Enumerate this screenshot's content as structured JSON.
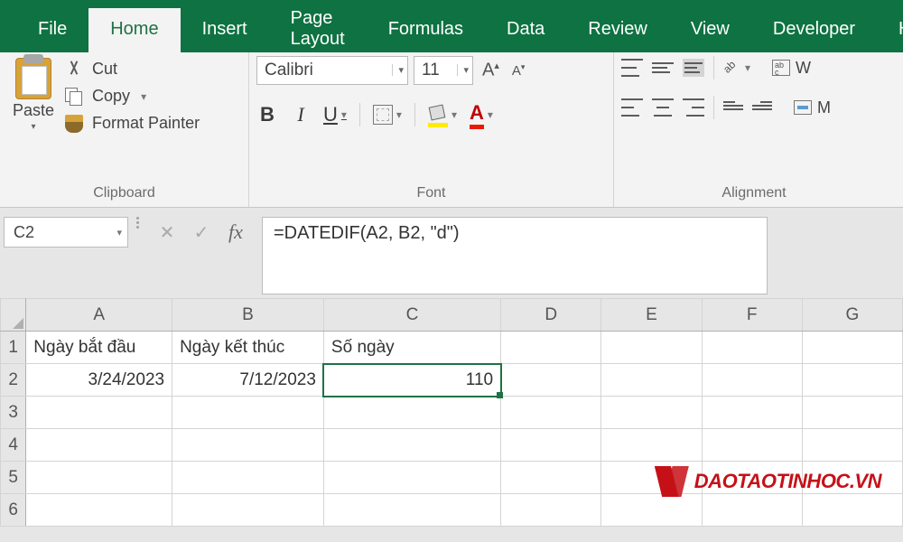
{
  "tabs": {
    "file": "File",
    "home": "Home",
    "insert": "Insert",
    "pageLayout": "Page Layout",
    "formulas": "Formulas",
    "data": "Data",
    "review": "Review",
    "view": "View",
    "developer": "Developer",
    "help": "H"
  },
  "clipboard": {
    "paste": "Paste",
    "cut": "Cut",
    "copy": "Copy",
    "formatPainter": "Format Painter",
    "label": "Clipboard"
  },
  "font": {
    "name": "Calibri",
    "size": "11",
    "bold": "B",
    "italic": "I",
    "underline": "U",
    "label": "Font",
    "color_accent": "#e81a00",
    "fill_accent": "#ffeb00"
  },
  "alignment": {
    "wrap": "W",
    "merge": "M",
    "label": "Alignment"
  },
  "nameBox": "C2",
  "formula": "=DATEDIF(A2, B2, \"d\")",
  "columns": [
    "A",
    "B",
    "C",
    "D",
    "E",
    "F",
    "G"
  ],
  "rows": [
    "1",
    "2",
    "3",
    "4",
    "5",
    "6"
  ],
  "cells": {
    "A1": "Ngày bắt đầu",
    "B1": "Ngày kết thúc",
    "C1": "Số ngày",
    "A2": "3/24/2023",
    "B2": "7/12/2023",
    "C2": "110"
  },
  "selectedCell": "C2",
  "watermark": "DAOTAOTINHOC.VN"
}
